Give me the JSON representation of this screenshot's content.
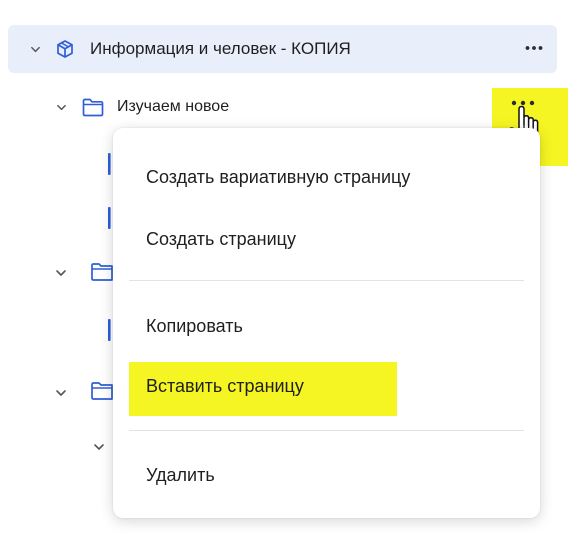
{
  "tree": {
    "project": {
      "label": "Информация и человек - КОПИЯ",
      "icon": "cube-icon"
    },
    "folder1": {
      "label": "Изучаем новое",
      "icon": "folder-icon"
    }
  },
  "context_menu": {
    "items": [
      {
        "label": "Создать вариативную страницу"
      },
      {
        "label": "Создать страницу"
      },
      {
        "label": "Копировать"
      },
      {
        "label": "Вставить страницу"
      },
      {
        "label": "Удалить"
      }
    ]
  },
  "colors": {
    "selected_row_bg": "#e9eefb",
    "highlight": "#f5f523",
    "accent_blue": "#2f5fd6",
    "text": "#1f1f1f",
    "separator": "#e3e3e3"
  }
}
